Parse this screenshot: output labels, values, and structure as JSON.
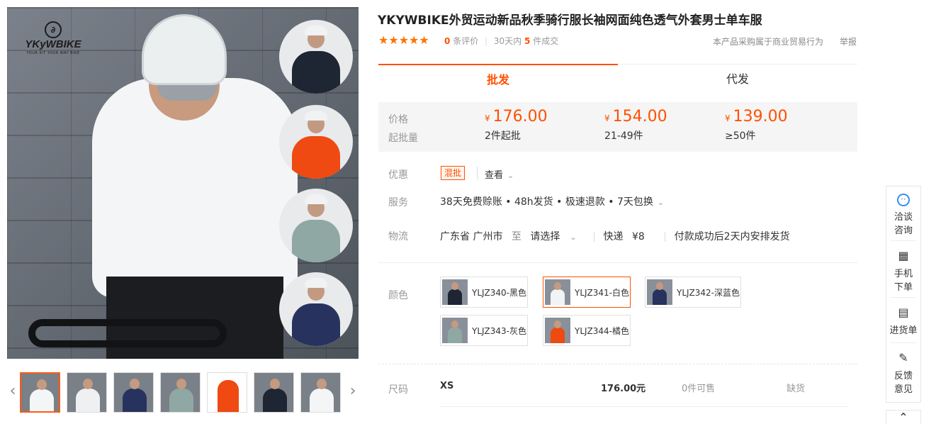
{
  "gallery": {
    "logo_name": "YKyWBIKE",
    "logo_tagline": "YOUR KIT YOUR WAY BIKE",
    "thumb_count": 7,
    "prev_label": "‹",
    "next_label": "›"
  },
  "product": {
    "title": "YKYWBIKE外贸运动新品秋季骑行服长袖网面纯色透气外套男士单车服",
    "stars": "★★★★★",
    "review_count": "0",
    "review_label": "条评价",
    "sales_prefix": "30天内",
    "sales_count": "5",
    "sales_suffix": "件成交",
    "trade_note": "本产品采购属于商业贸易行为",
    "report": "举报"
  },
  "tabs": {
    "wholesale": "批发",
    "dropship": "代发"
  },
  "pricing": {
    "price_label": "价格",
    "moq_label": "起批量",
    "currency": "¥",
    "tiers": [
      {
        "price": "176.00",
        "qty": "2件起批"
      },
      {
        "price": "154.00",
        "qty": "21-49件"
      },
      {
        "price": "139.00",
        "qty": "≥50件"
      }
    ]
  },
  "promo": {
    "label": "优惠",
    "badge": "混批",
    "view": "查看"
  },
  "service": {
    "label": "服务",
    "text": "38天免费赊账 • 48h发货 • 极速退款 • 7天包换"
  },
  "logistics": {
    "label": "物流",
    "origin": "广东省 广州市",
    "to": "至",
    "dest": "请选择",
    "express": "快递",
    "fee": "¥8",
    "ship_note": "付款成功后2天内安排发货"
  },
  "colors": {
    "label": "颜色",
    "items": [
      {
        "label": "YLJZ340-黑色",
        "color": "#1e2533"
      },
      {
        "label": "YLJZ341-白色",
        "color": "#f2f3f4"
      },
      {
        "label": "YLJZ342-深蓝色",
        "color": "#27335e"
      },
      {
        "label": "YLJZ343-灰色",
        "color": "#8fa8a4"
      },
      {
        "label": "YLJZ344-橘色",
        "color": "#ee4a12"
      }
    ],
    "selected_index": 1
  },
  "sizes": {
    "label": "尺码",
    "rows": [
      {
        "size": "XS",
        "price": "176.00元",
        "stock": "0件可售",
        "status": "缺货"
      }
    ]
  },
  "toolbar": {
    "consult": [
      "洽谈",
      "咨询"
    ],
    "mobile": [
      "手机",
      "下单"
    ],
    "cart": "进货单",
    "feedback": [
      "反馈",
      "意见"
    ]
  },
  "colors_theme": {
    "accent": "#ff5000",
    "star": "#ff7300",
    "price_bg": "#f5f5f5"
  }
}
